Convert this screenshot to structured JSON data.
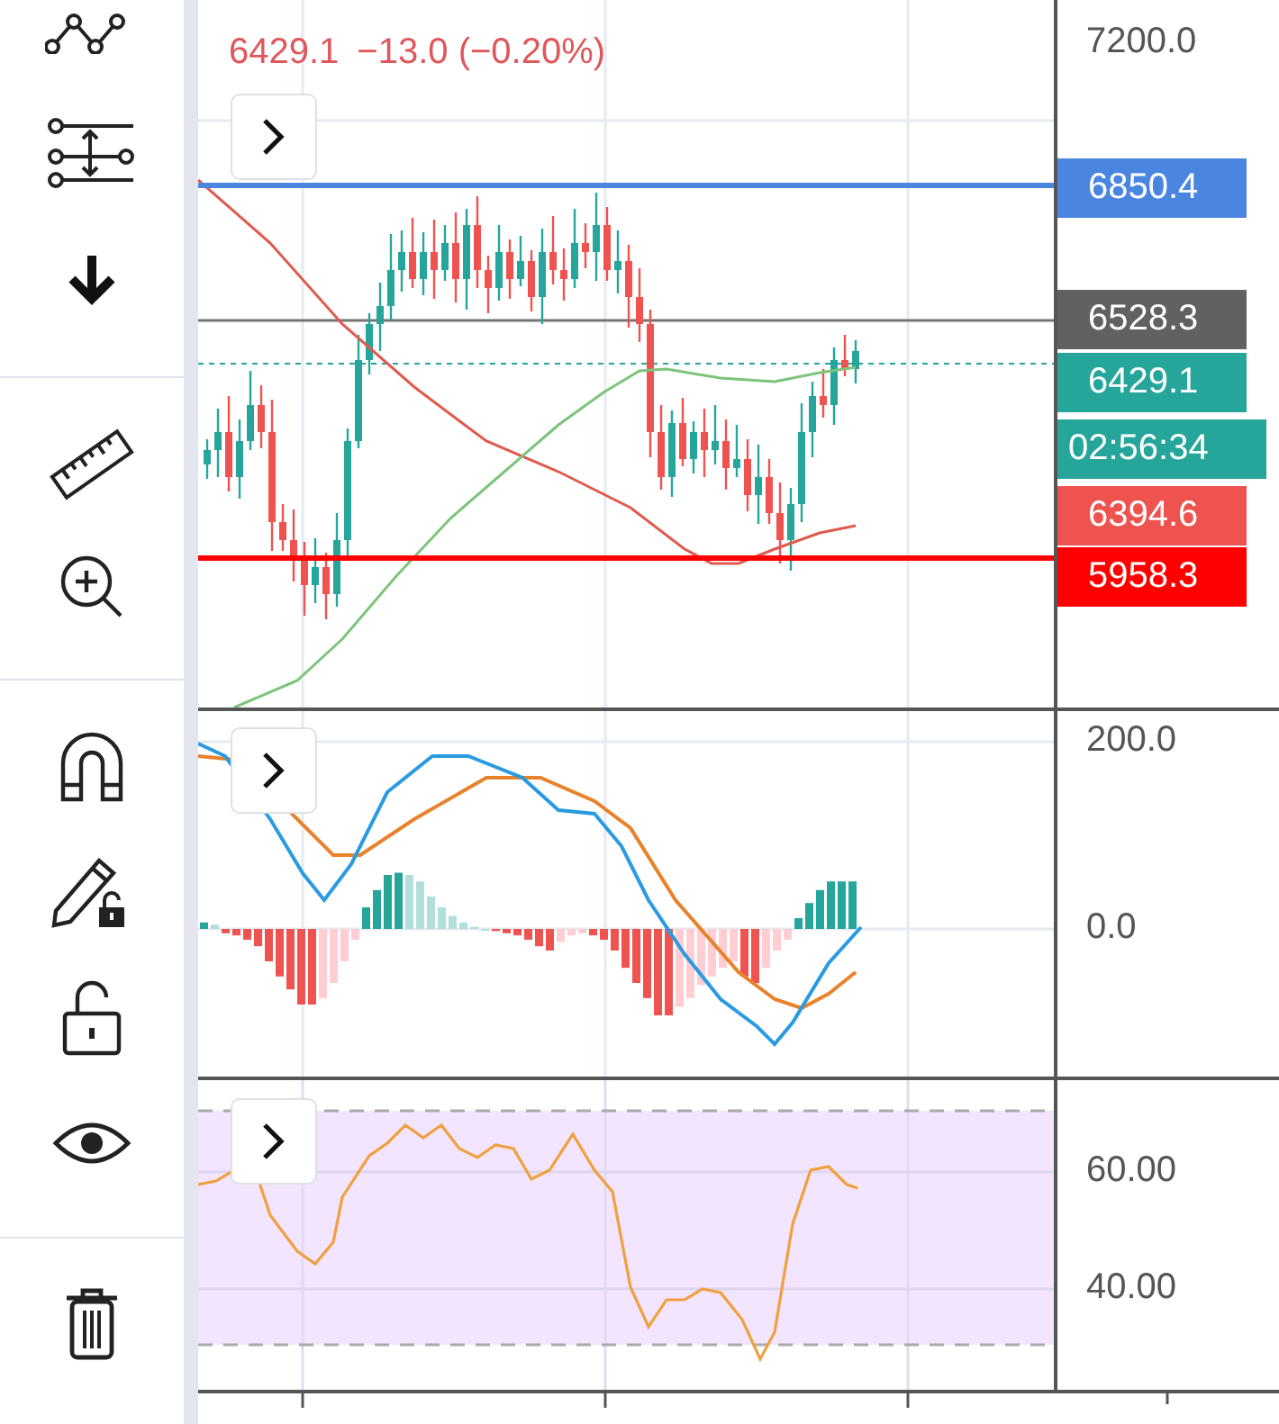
{
  "legend": {
    "price": "6429.1",
    "change": "−13.0 (−0.20%)"
  },
  "price_pane": {
    "axis_labels": [
      "7200.0"
    ],
    "price_tags": [
      {
        "label": "6850.4",
        "color": "#4a86e0"
      },
      {
        "label": "6528.3",
        "color": "#616161"
      },
      {
        "label": "6429.1",
        "color": "#26a69a"
      },
      {
        "label": "02:56:34",
        "color": "#26a69a"
      },
      {
        "label": "6394.6",
        "color": "#ef5350"
      },
      {
        "label": "5958.3",
        "color": "#ff0000"
      }
    ]
  },
  "macd_pane": {
    "axis_labels": [
      "200.0",
      "0.0"
    ]
  },
  "rsi_pane": {
    "axis_labels": [
      "60.00",
      "40.00"
    ]
  }
}
